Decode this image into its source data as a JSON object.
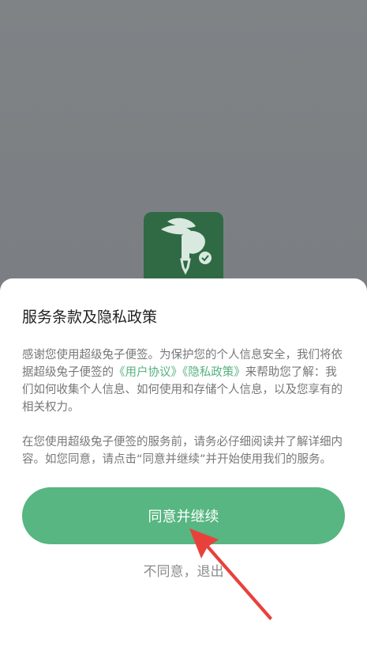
{
  "app": {
    "logo_icon": "rabbit-pen-check-icon"
  },
  "dialog": {
    "title": "服务条款及隐私政策",
    "paragraph1": {
      "text_before": "感谢您使用超级兔子便签。为保护您的个人信息安全，我们将依据超级兔子便签的",
      "user_agreement_link": "《用户协议》",
      "privacy_policy_link": "《隐私政策》",
      "text_after": "来帮助您了解：我们如何收集个人信息、如何使用和存储个人信息，以及您享有的相关权力。"
    },
    "paragraph2": " 在您使用超级兔子便签的服务前，请务必仔细阅读并了解详细内容。如您同意，请点击“同意并继续”并开始使用我们的服务。",
    "agree_button": "同意并继续",
    "decline_link": "不同意，退出"
  },
  "colors": {
    "accent": "#57b681",
    "link": "#55b27f",
    "backdrop": "#7c8083",
    "annotation_arrow": "#e8413c"
  }
}
